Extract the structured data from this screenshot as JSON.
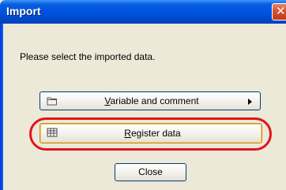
{
  "window": {
    "title": "Import",
    "close_glyph": "✕"
  },
  "body": {
    "prompt": "Please select the imported data."
  },
  "buttons": {
    "variable_comment": {
      "mnemonic": "V",
      "rest": "ariable and comment",
      "icon": "folder-icon"
    },
    "register_data": {
      "mnemonic": "R",
      "rest": "egister data",
      "icon": "table-icon"
    },
    "close": {
      "label": "Close"
    }
  },
  "annotation": {
    "highlight_color": "#e0141c"
  }
}
